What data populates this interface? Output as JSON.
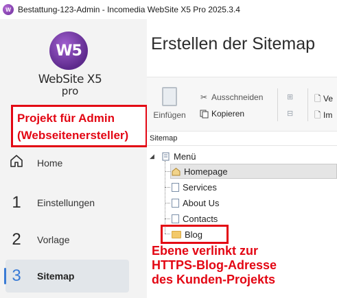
{
  "window": {
    "title": "Bestattung-123-Admin - Incomedia WebSite X5 Pro 2025.3.4",
    "app_icon": "ws5-app-icon",
    "accent": "#6b2d9a"
  },
  "logo": {
    "mark": "W5",
    "name": "WebSite X5",
    "edition": "pro"
  },
  "annotations": {
    "project_line1": "Projekt für Admin",
    "project_line2": "(Webseitenersteller)",
    "blog_line1": "Ebene verlinkt zur",
    "blog_line2": "HTTPS-Blog-Adresse",
    "blog_line3": "des Kunden-Projekts",
    "color": "#e30613"
  },
  "nav": {
    "items": [
      {
        "num": "",
        "label": "Home",
        "icon": "home-icon"
      },
      {
        "num": "1",
        "label": "Einstellungen"
      },
      {
        "num": "2",
        "label": "Vorlage"
      },
      {
        "num": "3",
        "label": "Sitemap",
        "active": true
      }
    ]
  },
  "main": {
    "title": "Erstellen der Sitemap"
  },
  "toolbar": {
    "paste": "Einfügen",
    "cut": "Ausschneiden",
    "copy": "Kopieren",
    "right1": "Ve",
    "right2": "Im"
  },
  "sitemap": {
    "label": "Sitemap",
    "root": "Menü",
    "items": [
      {
        "label": "Homepage",
        "icon": "home-page-icon",
        "selected": true
      },
      {
        "label": "Services",
        "icon": "page-icon"
      },
      {
        "label": "About Us",
        "icon": "page-icon"
      },
      {
        "label": "Contacts",
        "icon": "page-icon"
      },
      {
        "label": "Blog",
        "icon": "folder-icon"
      }
    ]
  }
}
